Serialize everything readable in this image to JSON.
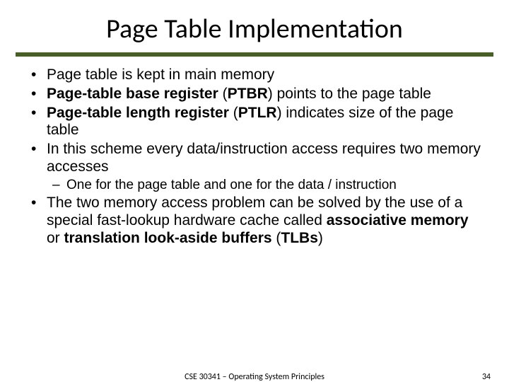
{
  "title": "Page Table Implementation",
  "bullets": {
    "b1": "Page table is kept in main memory",
    "b2a": "Page-table base register",
    "b2b": " (",
    "b2c": "PTBR",
    "b2d": ") points to the page table",
    "b3a": "Page-table length register",
    "b3b": " (",
    "b3c": "PTLR",
    "b3d": ") indicates size of the page table",
    "b4": "In this scheme every data/instruction access requires two memory accesses",
    "b4_sub": "One for the page table and one for the data / instruction",
    "b5a": "The two memory access problem can be solved by the use of a special fast-lookup hardware cache called ",
    "b5b": "associative memory",
    "b5c": " or ",
    "b5d": "translation look-aside buffers",
    "b5e": " (",
    "b5f": "TLBs",
    "b5g": ")"
  },
  "footer": "CSE 30341 – Operating System Principles",
  "page_number": "34"
}
